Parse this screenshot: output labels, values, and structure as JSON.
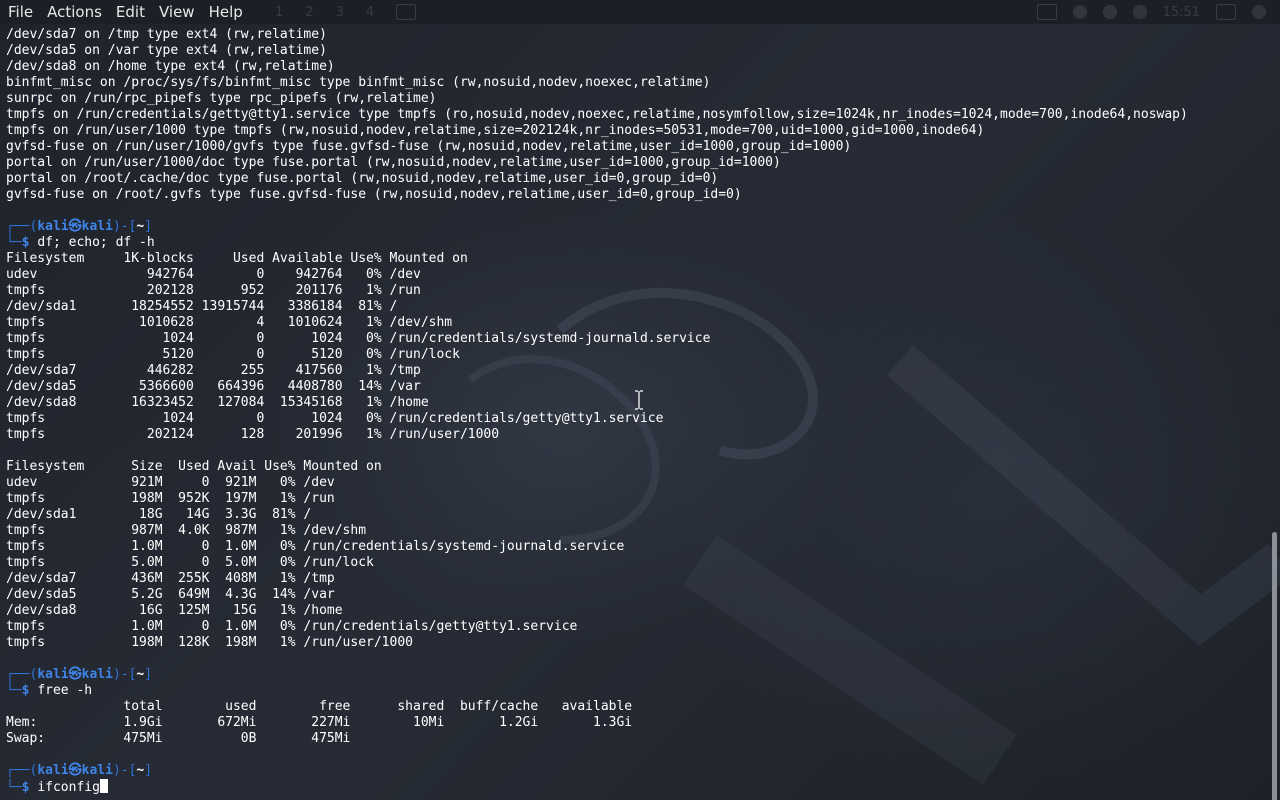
{
  "menubar": {
    "items": [
      "File",
      "Actions",
      "Edit",
      "View",
      "Help"
    ]
  },
  "panel": {
    "workspaces": [
      "1",
      "2",
      "3",
      "4"
    ],
    "clock": "15:51"
  },
  "prompt": {
    "user": "kali",
    "at": "㉿",
    "host": "kali",
    "dir": "~"
  },
  "terminal": {
    "lines": [
      {
        "type": "out",
        "text": "/dev/sda7 on /tmp type ext4 (rw,relatime)"
      },
      {
        "type": "out",
        "text": "/dev/sda5 on /var type ext4 (rw,relatime)"
      },
      {
        "type": "out",
        "text": "/dev/sda8 on /home type ext4 (rw,relatime)"
      },
      {
        "type": "out",
        "text": "binfmt_misc on /proc/sys/fs/binfmt_misc type binfmt_misc (rw,nosuid,nodev,noexec,relatime)"
      },
      {
        "type": "out",
        "text": "sunrpc on /run/rpc_pipefs type rpc_pipefs (rw,relatime)"
      },
      {
        "type": "out",
        "text": "tmpfs on /run/credentials/getty@tty1.service type tmpfs (ro,nosuid,nodev,noexec,relatime,nosymfollow,size=1024k,nr_inodes=1024,mode=700,inode64,noswap)"
      },
      {
        "type": "out",
        "text": "tmpfs on /run/user/1000 type tmpfs (rw,nosuid,nodev,relatime,size=202124k,nr_inodes=50531,mode=700,uid=1000,gid=1000,inode64)"
      },
      {
        "type": "out",
        "text": "gvfsd-fuse on /run/user/1000/gvfs type fuse.gvfsd-fuse (rw,nosuid,nodev,relatime,user_id=1000,group_id=1000)"
      },
      {
        "type": "out",
        "text": "portal on /run/user/1000/doc type fuse.portal (rw,nosuid,nodev,relatime,user_id=1000,group_id=1000)"
      },
      {
        "type": "out",
        "text": "portal on /root/.cache/doc type fuse.portal (rw,nosuid,nodev,relatime,user_id=0,group_id=0)"
      },
      {
        "type": "out",
        "text": "gvfsd-fuse on /root/.gvfs type fuse.gvfsd-fuse (rw,nosuid,nodev,relatime,user_id=0,group_id=0)"
      },
      {
        "type": "blank",
        "text": ""
      },
      {
        "type": "prompt-top",
        "text": ""
      },
      {
        "type": "prompt-bot",
        "text": "df; echo; df -h"
      },
      {
        "type": "out",
        "text": "Filesystem     1K-blocks     Used Available Use% Mounted on"
      },
      {
        "type": "out",
        "text": "udev              942764        0    942764   0% /dev"
      },
      {
        "type": "out",
        "text": "tmpfs             202128      952    201176   1% /run"
      },
      {
        "type": "out",
        "text": "/dev/sda1       18254552 13915744   3386184  81% /"
      },
      {
        "type": "out",
        "text": "tmpfs            1010628        4   1010624   1% /dev/shm"
      },
      {
        "type": "out",
        "text": "tmpfs               1024        0      1024   0% /run/credentials/systemd-journald.service"
      },
      {
        "type": "out",
        "text": "tmpfs               5120        0      5120   0% /run/lock"
      },
      {
        "type": "out",
        "text": "/dev/sda7         446282      255    417560   1% /tmp"
      },
      {
        "type": "out",
        "text": "/dev/sda5        5366600   664396   4408780  14% /var"
      },
      {
        "type": "out",
        "text": "/dev/sda8       16323452   127084  15345168   1% /home"
      },
      {
        "type": "out",
        "text": "tmpfs               1024        0      1024   0% /run/credentials/getty@tty1.service"
      },
      {
        "type": "out",
        "text": "tmpfs             202124      128    201996   1% /run/user/1000"
      },
      {
        "type": "blank",
        "text": ""
      },
      {
        "type": "out",
        "text": "Filesystem      Size  Used Avail Use% Mounted on"
      },
      {
        "type": "out",
        "text": "udev            921M     0  921M   0% /dev"
      },
      {
        "type": "out",
        "text": "tmpfs           198M  952K  197M   1% /run"
      },
      {
        "type": "out",
        "text": "/dev/sda1        18G   14G  3.3G  81% /"
      },
      {
        "type": "out",
        "text": "tmpfs           987M  4.0K  987M   1% /dev/shm"
      },
      {
        "type": "out",
        "text": "tmpfs           1.0M     0  1.0M   0% /run/credentials/systemd-journald.service"
      },
      {
        "type": "out",
        "text": "tmpfs           5.0M     0  5.0M   0% /run/lock"
      },
      {
        "type": "out",
        "text": "/dev/sda7       436M  255K  408M   1% /tmp"
      },
      {
        "type": "out",
        "text": "/dev/sda5       5.2G  649M  4.3G  14% /var"
      },
      {
        "type": "out",
        "text": "/dev/sda8        16G  125M   15G   1% /home"
      },
      {
        "type": "out",
        "text": "tmpfs           1.0M     0  1.0M   0% /run/credentials/getty@tty1.service"
      },
      {
        "type": "out",
        "text": "tmpfs           198M  128K  198M   1% /run/user/1000"
      },
      {
        "type": "blank",
        "text": ""
      },
      {
        "type": "prompt-top",
        "text": ""
      },
      {
        "type": "prompt-bot",
        "text": "free -h"
      },
      {
        "type": "out",
        "text": "               total        used        free      shared  buff/cache   available"
      },
      {
        "type": "out",
        "text": "Mem:           1.9Gi       672Mi       227Mi        10Mi       1.2Gi       1.3Gi"
      },
      {
        "type": "out",
        "text": "Swap:          475Mi          0B       475Mi"
      },
      {
        "type": "blank",
        "text": ""
      },
      {
        "type": "prompt-top",
        "text": ""
      },
      {
        "type": "prompt-bot",
        "text": "ifconfig",
        "cursor": true
      }
    ]
  },
  "colors": {
    "prompt_frame": "#2c73d2",
    "prompt_user": "#3e84e6",
    "text": "#ffffff",
    "background": "#1e222a"
  }
}
